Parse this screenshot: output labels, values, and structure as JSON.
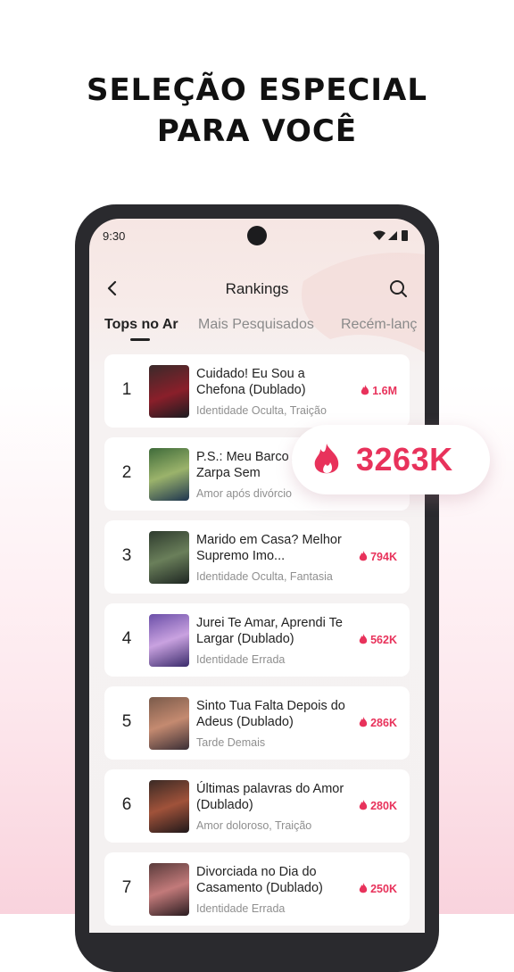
{
  "headline": {
    "line1": "SELEÇÃO ESPECIAL",
    "line2": "PARA VOCÊ"
  },
  "status_bar": {
    "time": "9:30"
  },
  "nav": {
    "title": "Rankings"
  },
  "tabs": [
    {
      "label": "Tops no Ar",
      "active": true
    },
    {
      "label": "Mais Pesquisados",
      "active": false
    },
    {
      "label": "Recém-lanç",
      "active": false
    }
  ],
  "accent_color": "#e8325b",
  "items": [
    {
      "rank": "1",
      "title": "Cuidado! Eu Sou a Chefona (Dublado)",
      "genre": "Identidade Oculta, Traição",
      "views": "1.6M"
    },
    {
      "rank": "2",
      "title": "P.S.: Meu Barco Amor Zarpa Sem",
      "genre": "Amor após divórcio",
      "views": ""
    },
    {
      "rank": "3",
      "title": "Marido em Casa? Melhor Supremo Imo...",
      "genre": "Identidade Oculta, Fantasia",
      "views": "794K"
    },
    {
      "rank": "4",
      "title": "Jurei Te Amar, Aprendi Te Largar (Dublado)",
      "genre": "Identidade Errada",
      "views": "562K"
    },
    {
      "rank": "5",
      "title": "Sinto Tua Falta Depois do Adeus (Dublado)",
      "genre": "Tarde Demais",
      "views": "286K"
    },
    {
      "rank": "6",
      "title": "Últimas palavras do Amor (Dublado)",
      "genre": "Amor doloroso, Traição",
      "views": "280K"
    },
    {
      "rank": "7",
      "title": "Divorciada no Dia do Casamento (Dublado)",
      "genre": "Identidade Errada",
      "views": "250K"
    }
  ],
  "highlight_badge": {
    "value": "3263K",
    "icon": "flame-icon"
  }
}
